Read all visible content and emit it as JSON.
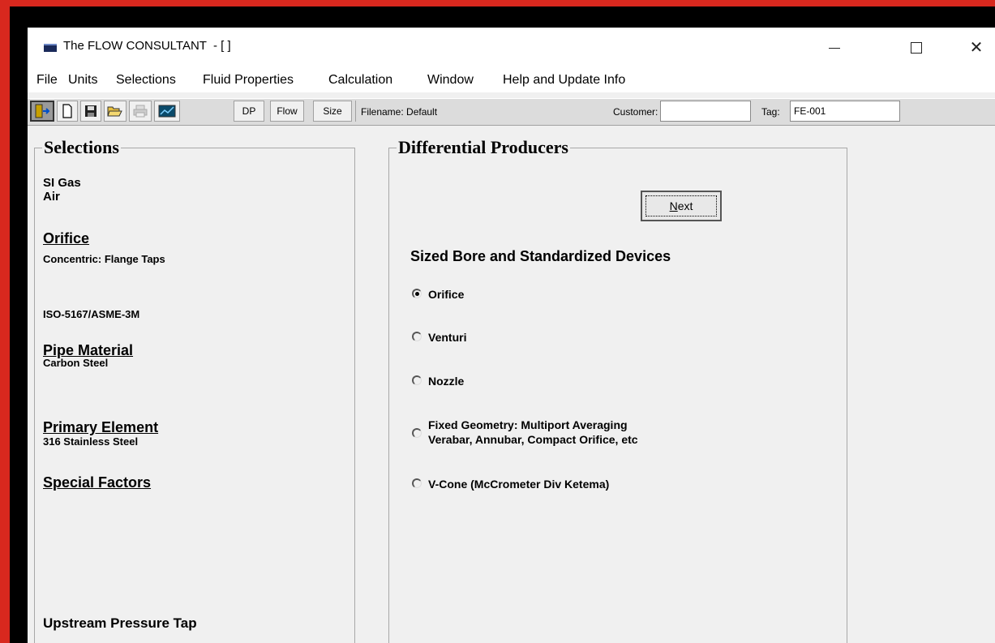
{
  "window": {
    "title": "The FLOW CONSULTANT  - [ ]",
    "minimize": "—",
    "maximize": "☐",
    "close": "✕"
  },
  "menu": [
    "File",
    "Units",
    "Selections",
    "Fluid Properties",
    "Calculation",
    "Window",
    "Help and Update Info"
  ],
  "toolbar": {
    "dp_label": "DP",
    "flow_label": "Flow",
    "size_label": "Size",
    "filename_text": "Filename: Default",
    "customer_label": "Customer:",
    "customer_value": "",
    "tag_label": "Tag:",
    "tag_value": "FE-001"
  },
  "selections": {
    "title": "Selections",
    "fluid_type": "SI Gas",
    "fluid_name": "Air",
    "orifice_head": "Orifice",
    "orifice_detail": "Concentric: Flange Taps",
    "standard": "ISO-5167/ASME-3M",
    "pipe_head": "Pipe Material",
    "pipe_value": "Carbon Steel",
    "primary_head": "Primary Element ",
    "primary_value": "316 Stainless Steel",
    "special_head": "Special Factors",
    "upstream": "Upstream Pressure Tap"
  },
  "producers": {
    "title": "Differential Producers",
    "next_label": "Next",
    "section": "Sized Bore and Standardized Devices",
    "options": [
      {
        "label": "Orifice",
        "selected": true
      },
      {
        "label": "Venturi",
        "selected": false
      },
      {
        "label": "Nozzle",
        "selected": false
      },
      {
        "label": "Fixed Geometry: Multiport Averaging",
        "label2": "Verabar, Annubar, Compact Orifice, etc",
        "selected": false
      },
      {
        "label": "V-Cone (McCrometer Div Ketema)",
        "selected": false
      }
    ]
  }
}
